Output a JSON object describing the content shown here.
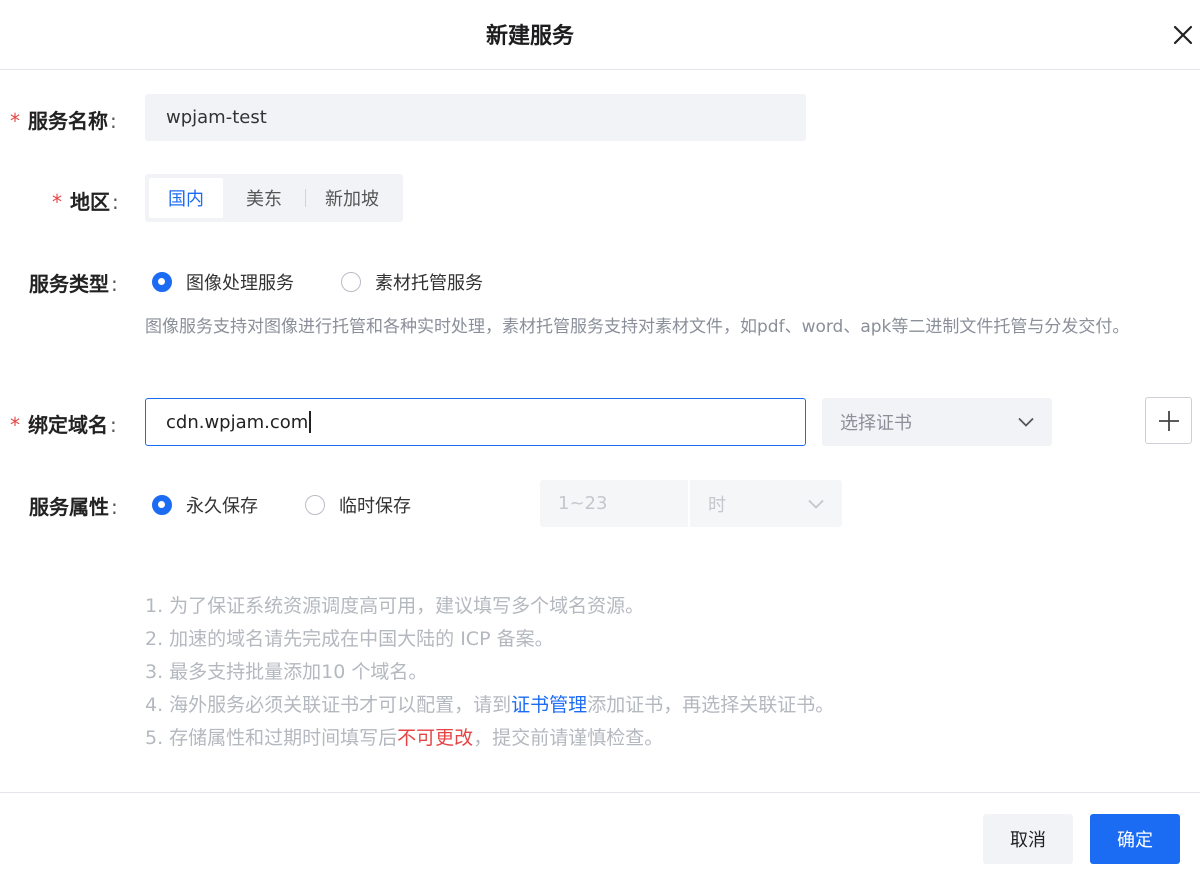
{
  "dialog": {
    "title": "新建服务"
  },
  "form": {
    "service_name": {
      "label": "服务名称",
      "value": "wpjam-test"
    },
    "region": {
      "label": "地区",
      "options": [
        "国内",
        "美东",
        "新加坡"
      ],
      "selected": "国内"
    },
    "service_type": {
      "label": "服务类型",
      "options": [
        "图像处理服务",
        "素材托管服务"
      ],
      "selected": "图像处理服务",
      "description": "图像服务支持对图像进行托管和各种实时处理，素材托管服务支持对素材文件，如pdf、word、apk等二进制文件托管与分发交付。"
    },
    "domain": {
      "label": "绑定域名",
      "value": "cdn.wpjam.com",
      "cert_placeholder": "选择证书"
    },
    "attribute": {
      "label": "服务属性",
      "options": [
        "永久保存",
        "临时保存"
      ],
      "selected": "永久保存",
      "duration_placeholder": "1~23",
      "unit": "时"
    }
  },
  "notes": {
    "n1": "1. 为了保证系统资源调度高可用，建议填写多个域名资源。",
    "n2": "2. 加速的域名请先完成在中国大陆的 ICP 备案。",
    "n3": "3. 最多支持批量添加10 个域名。",
    "n4_pre": "4. 海外服务必须关联证书才可以配置，请到",
    "n4_link": "证书管理",
    "n4_post": "添加证书，再选择关联证书。",
    "n5_pre": "5. 存储属性和过期时间填写后",
    "n5_warn": "不可更改",
    "n5_post": "，提交前请谨慎检查。"
  },
  "footer": {
    "cancel_label": "取消",
    "ok_label": "确定"
  },
  "colors": {
    "primary": "#1c6cf3",
    "required": "#e54545",
    "field_bg": "#f2f3f7"
  }
}
